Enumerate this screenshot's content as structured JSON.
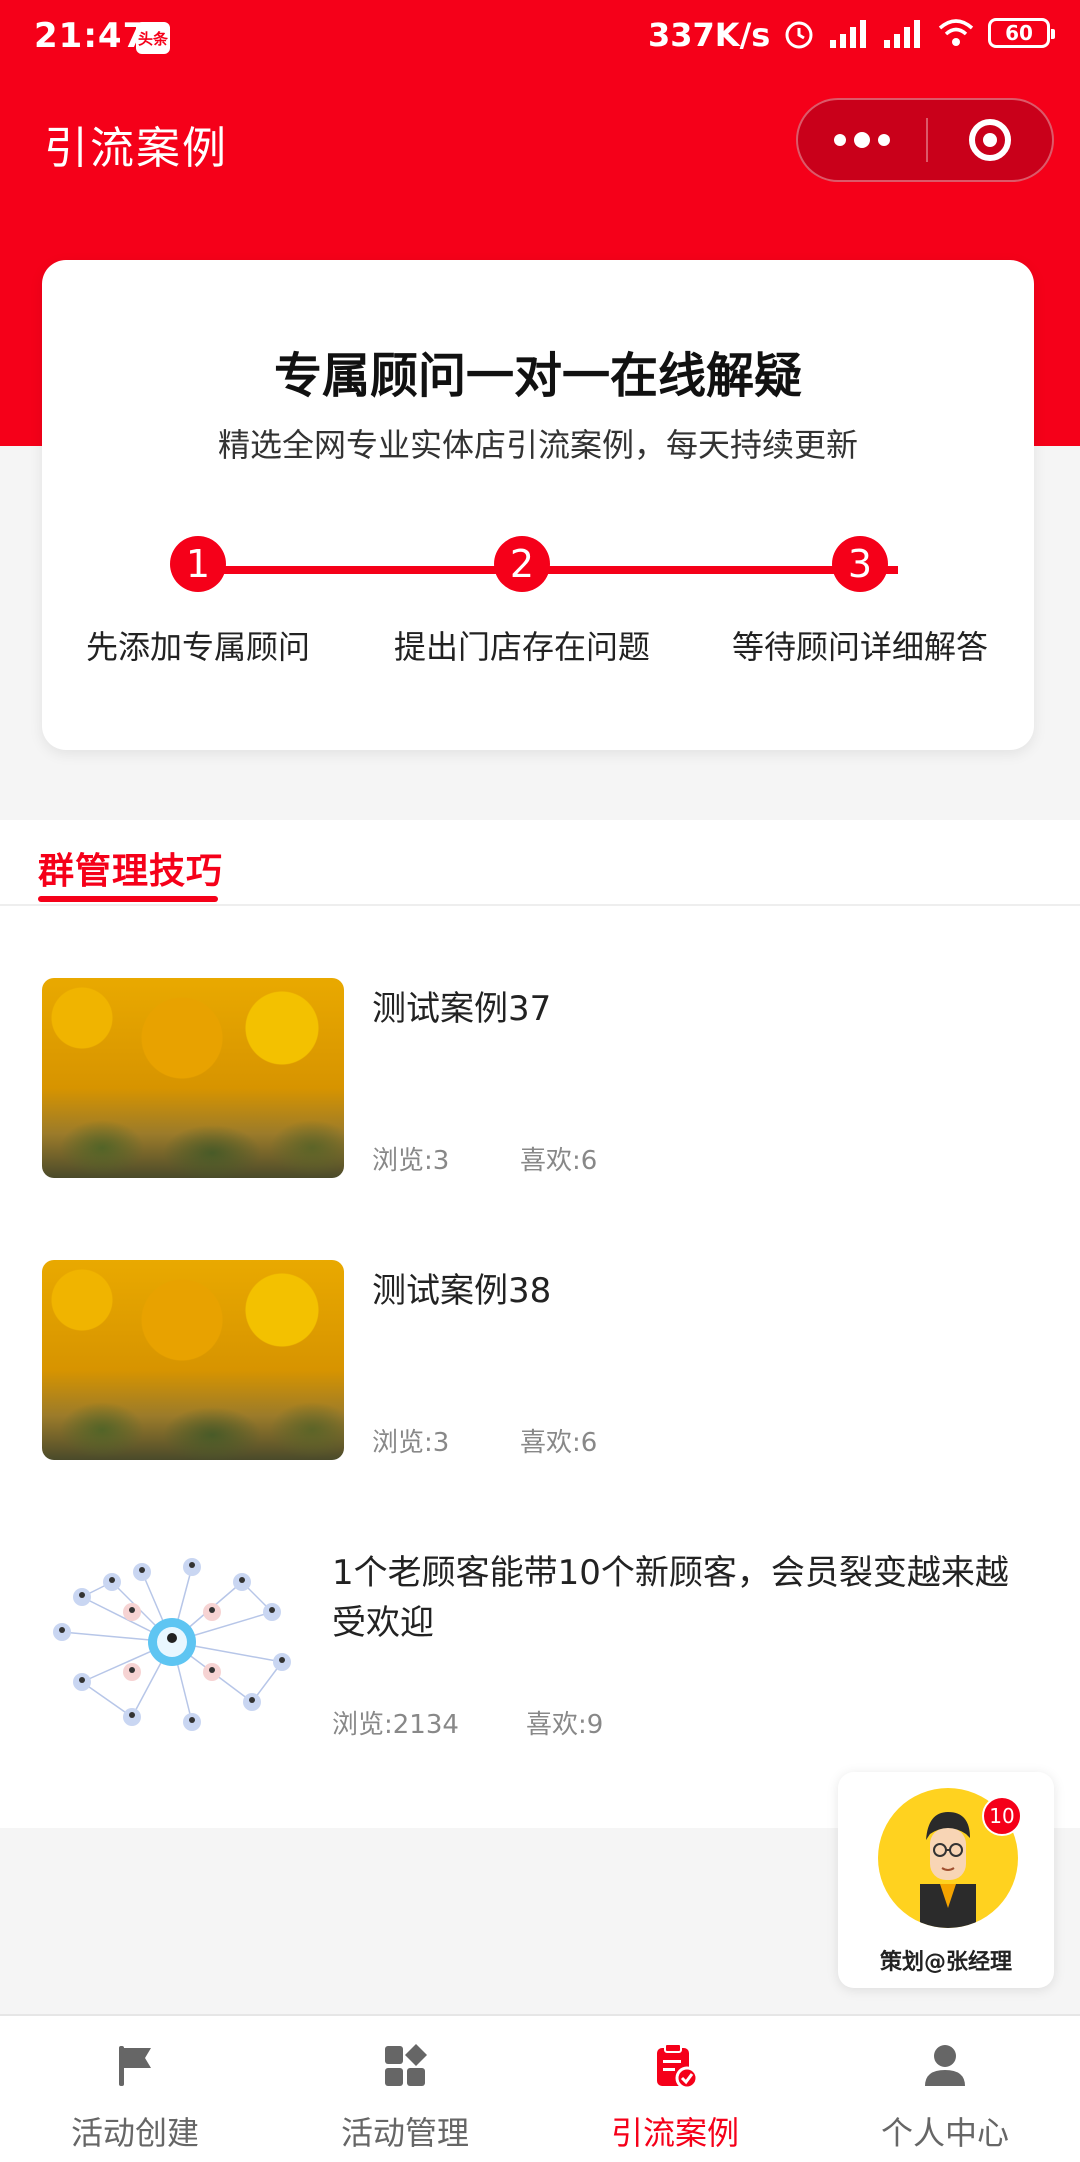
{
  "status_bar": {
    "time": "21:47",
    "app_icon_text": "头条",
    "network_speed": "337K/s",
    "battery": "60",
    "icons": [
      "alarm-icon",
      "signal-icon",
      "signal-icon",
      "wifi-icon",
      "battery-icon"
    ]
  },
  "nav": {
    "title": "引流案例",
    "more_icon": "more-dots-icon",
    "close_icon": "target-circle-icon"
  },
  "advisor": {
    "title": "专属顾问一对一在线解疑",
    "subtitle": "精选全网专业实体店引流案例，每天持续更新",
    "steps": [
      {
        "number": "1",
        "label": "先添加专属顾问"
      },
      {
        "number": "2",
        "label": "提出门店存在问题"
      },
      {
        "number": "3",
        "label": "等待顾问详细解答"
      }
    ]
  },
  "section": {
    "active_tab": "群管理技巧"
  },
  "cases": [
    {
      "title": "测试案例37",
      "views": "浏览:3",
      "likes": "喜欢:6"
    },
    {
      "title": "测试案例38",
      "views": "浏览:3",
      "likes": "喜欢:6"
    },
    {
      "title": "1个老顾客能带10个新顾客，会员裂变越来越受欢迎",
      "views": "浏览:2134",
      "likes": "喜欢:9"
    }
  ],
  "consultant": {
    "badge": "10",
    "label": "策划@张经理"
  },
  "tabbar": {
    "items": [
      {
        "label": "活动创建",
        "icon": "flag-icon"
      },
      {
        "label": "活动管理",
        "icon": "grid-icon"
      },
      {
        "label": "引流案例",
        "icon": "clipboard-check-icon"
      },
      {
        "label": "个人中心",
        "icon": "person-icon"
      }
    ],
    "active_index": 2
  },
  "colors": {
    "primary": "#f50019",
    "background": "#f5f5f5"
  }
}
